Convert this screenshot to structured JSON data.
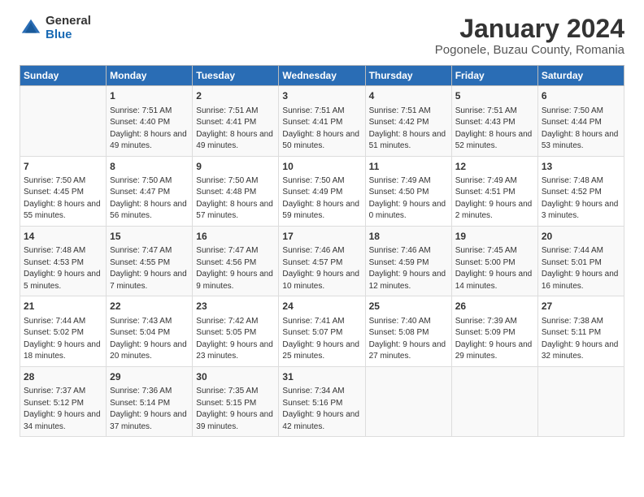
{
  "header": {
    "logo_general": "General",
    "logo_blue": "Blue",
    "main_title": "January 2024",
    "subtitle": "Pogonele, Buzau County, Romania"
  },
  "days_of_week": [
    "Sunday",
    "Monday",
    "Tuesday",
    "Wednesday",
    "Thursday",
    "Friday",
    "Saturday"
  ],
  "weeks": [
    [
      {
        "day": "",
        "sunrise": "",
        "sunset": "",
        "daylight": ""
      },
      {
        "day": "1",
        "sunrise": "Sunrise: 7:51 AM",
        "sunset": "Sunset: 4:40 PM",
        "daylight": "Daylight: 8 hours and 49 minutes."
      },
      {
        "day": "2",
        "sunrise": "Sunrise: 7:51 AM",
        "sunset": "Sunset: 4:41 PM",
        "daylight": "Daylight: 8 hours and 49 minutes."
      },
      {
        "day": "3",
        "sunrise": "Sunrise: 7:51 AM",
        "sunset": "Sunset: 4:41 PM",
        "daylight": "Daylight: 8 hours and 50 minutes."
      },
      {
        "day": "4",
        "sunrise": "Sunrise: 7:51 AM",
        "sunset": "Sunset: 4:42 PM",
        "daylight": "Daylight: 8 hours and 51 minutes."
      },
      {
        "day": "5",
        "sunrise": "Sunrise: 7:51 AM",
        "sunset": "Sunset: 4:43 PM",
        "daylight": "Daylight: 8 hours and 52 minutes."
      },
      {
        "day": "6",
        "sunrise": "Sunrise: 7:50 AM",
        "sunset": "Sunset: 4:44 PM",
        "daylight": "Daylight: 8 hours and 53 minutes."
      }
    ],
    [
      {
        "day": "7",
        "sunrise": "Sunrise: 7:50 AM",
        "sunset": "Sunset: 4:45 PM",
        "daylight": "Daylight: 8 hours and 55 minutes."
      },
      {
        "day": "8",
        "sunrise": "Sunrise: 7:50 AM",
        "sunset": "Sunset: 4:47 PM",
        "daylight": "Daylight: 8 hours and 56 minutes."
      },
      {
        "day": "9",
        "sunrise": "Sunrise: 7:50 AM",
        "sunset": "Sunset: 4:48 PM",
        "daylight": "Daylight: 8 hours and 57 minutes."
      },
      {
        "day": "10",
        "sunrise": "Sunrise: 7:50 AM",
        "sunset": "Sunset: 4:49 PM",
        "daylight": "Daylight: 8 hours and 59 minutes."
      },
      {
        "day": "11",
        "sunrise": "Sunrise: 7:49 AM",
        "sunset": "Sunset: 4:50 PM",
        "daylight": "Daylight: 9 hours and 0 minutes."
      },
      {
        "day": "12",
        "sunrise": "Sunrise: 7:49 AM",
        "sunset": "Sunset: 4:51 PM",
        "daylight": "Daylight: 9 hours and 2 minutes."
      },
      {
        "day": "13",
        "sunrise": "Sunrise: 7:48 AM",
        "sunset": "Sunset: 4:52 PM",
        "daylight": "Daylight: 9 hours and 3 minutes."
      }
    ],
    [
      {
        "day": "14",
        "sunrise": "Sunrise: 7:48 AM",
        "sunset": "Sunset: 4:53 PM",
        "daylight": "Daylight: 9 hours and 5 minutes."
      },
      {
        "day": "15",
        "sunrise": "Sunrise: 7:47 AM",
        "sunset": "Sunset: 4:55 PM",
        "daylight": "Daylight: 9 hours and 7 minutes."
      },
      {
        "day": "16",
        "sunrise": "Sunrise: 7:47 AM",
        "sunset": "Sunset: 4:56 PM",
        "daylight": "Daylight: 9 hours and 9 minutes."
      },
      {
        "day": "17",
        "sunrise": "Sunrise: 7:46 AM",
        "sunset": "Sunset: 4:57 PM",
        "daylight": "Daylight: 9 hours and 10 minutes."
      },
      {
        "day": "18",
        "sunrise": "Sunrise: 7:46 AM",
        "sunset": "Sunset: 4:59 PM",
        "daylight": "Daylight: 9 hours and 12 minutes."
      },
      {
        "day": "19",
        "sunrise": "Sunrise: 7:45 AM",
        "sunset": "Sunset: 5:00 PM",
        "daylight": "Daylight: 9 hours and 14 minutes."
      },
      {
        "day": "20",
        "sunrise": "Sunrise: 7:44 AM",
        "sunset": "Sunset: 5:01 PM",
        "daylight": "Daylight: 9 hours and 16 minutes."
      }
    ],
    [
      {
        "day": "21",
        "sunrise": "Sunrise: 7:44 AM",
        "sunset": "Sunset: 5:02 PM",
        "daylight": "Daylight: 9 hours and 18 minutes."
      },
      {
        "day": "22",
        "sunrise": "Sunrise: 7:43 AM",
        "sunset": "Sunset: 5:04 PM",
        "daylight": "Daylight: 9 hours and 20 minutes."
      },
      {
        "day": "23",
        "sunrise": "Sunrise: 7:42 AM",
        "sunset": "Sunset: 5:05 PM",
        "daylight": "Daylight: 9 hours and 23 minutes."
      },
      {
        "day": "24",
        "sunrise": "Sunrise: 7:41 AM",
        "sunset": "Sunset: 5:07 PM",
        "daylight": "Daylight: 9 hours and 25 minutes."
      },
      {
        "day": "25",
        "sunrise": "Sunrise: 7:40 AM",
        "sunset": "Sunset: 5:08 PM",
        "daylight": "Daylight: 9 hours and 27 minutes."
      },
      {
        "day": "26",
        "sunrise": "Sunrise: 7:39 AM",
        "sunset": "Sunset: 5:09 PM",
        "daylight": "Daylight: 9 hours and 29 minutes."
      },
      {
        "day": "27",
        "sunrise": "Sunrise: 7:38 AM",
        "sunset": "Sunset: 5:11 PM",
        "daylight": "Daylight: 9 hours and 32 minutes."
      }
    ],
    [
      {
        "day": "28",
        "sunrise": "Sunrise: 7:37 AM",
        "sunset": "Sunset: 5:12 PM",
        "daylight": "Daylight: 9 hours and 34 minutes."
      },
      {
        "day": "29",
        "sunrise": "Sunrise: 7:36 AM",
        "sunset": "Sunset: 5:14 PM",
        "daylight": "Daylight: 9 hours and 37 minutes."
      },
      {
        "day": "30",
        "sunrise": "Sunrise: 7:35 AM",
        "sunset": "Sunset: 5:15 PM",
        "daylight": "Daylight: 9 hours and 39 minutes."
      },
      {
        "day": "31",
        "sunrise": "Sunrise: 7:34 AM",
        "sunset": "Sunset: 5:16 PM",
        "daylight": "Daylight: 9 hours and 42 minutes."
      },
      {
        "day": "",
        "sunrise": "",
        "sunset": "",
        "daylight": ""
      },
      {
        "day": "",
        "sunrise": "",
        "sunset": "",
        "daylight": ""
      },
      {
        "day": "",
        "sunrise": "",
        "sunset": "",
        "daylight": ""
      }
    ]
  ]
}
